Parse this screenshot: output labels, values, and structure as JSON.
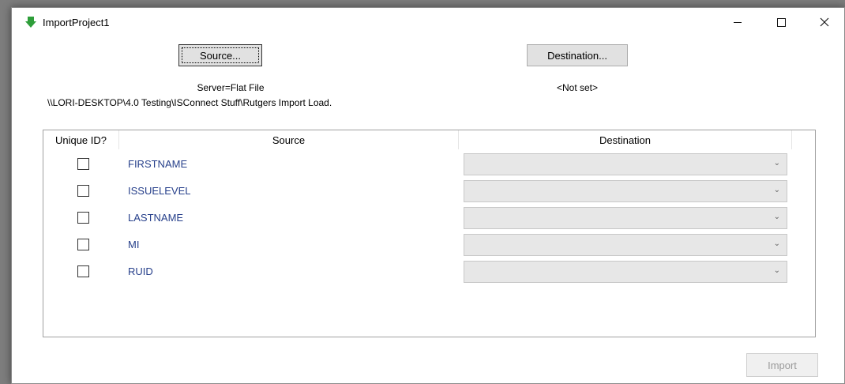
{
  "window": {
    "title": "ImportProject1"
  },
  "source": {
    "button_label": "Source...",
    "server": "Server=Flat File",
    "path": "\\\\LORI-DESKTOP\\4.0 Testing\\ISConnect Stuff\\Rutgers Import Load."
  },
  "destination": {
    "button_label": "Destination...",
    "status": "<Not set>"
  },
  "grid": {
    "headers": {
      "unique": "Unique ID?",
      "source": "Source",
      "destination": "Destination"
    },
    "rows": [
      {
        "field": "FIRSTNAME",
        "unique": false,
        "destination": ""
      },
      {
        "field": "ISSUELEVEL",
        "unique": false,
        "destination": ""
      },
      {
        "field": "LASTNAME",
        "unique": false,
        "destination": ""
      },
      {
        "field": "MI",
        "unique": false,
        "destination": ""
      },
      {
        "field": "RUID",
        "unique": false,
        "destination": ""
      }
    ]
  },
  "actions": {
    "import_label": "Import",
    "import_enabled": false
  },
  "icons": {
    "app": "green-down-arrow-icon",
    "minimize": "minimize-icon",
    "maximize": "maximize-icon",
    "close": "close-icon",
    "dropdown": "chevron-down-icon"
  },
  "colors": {
    "field_text": "#27408b",
    "app_icon": "#2e9e3a",
    "disabled_text": "#9a9a9a"
  }
}
